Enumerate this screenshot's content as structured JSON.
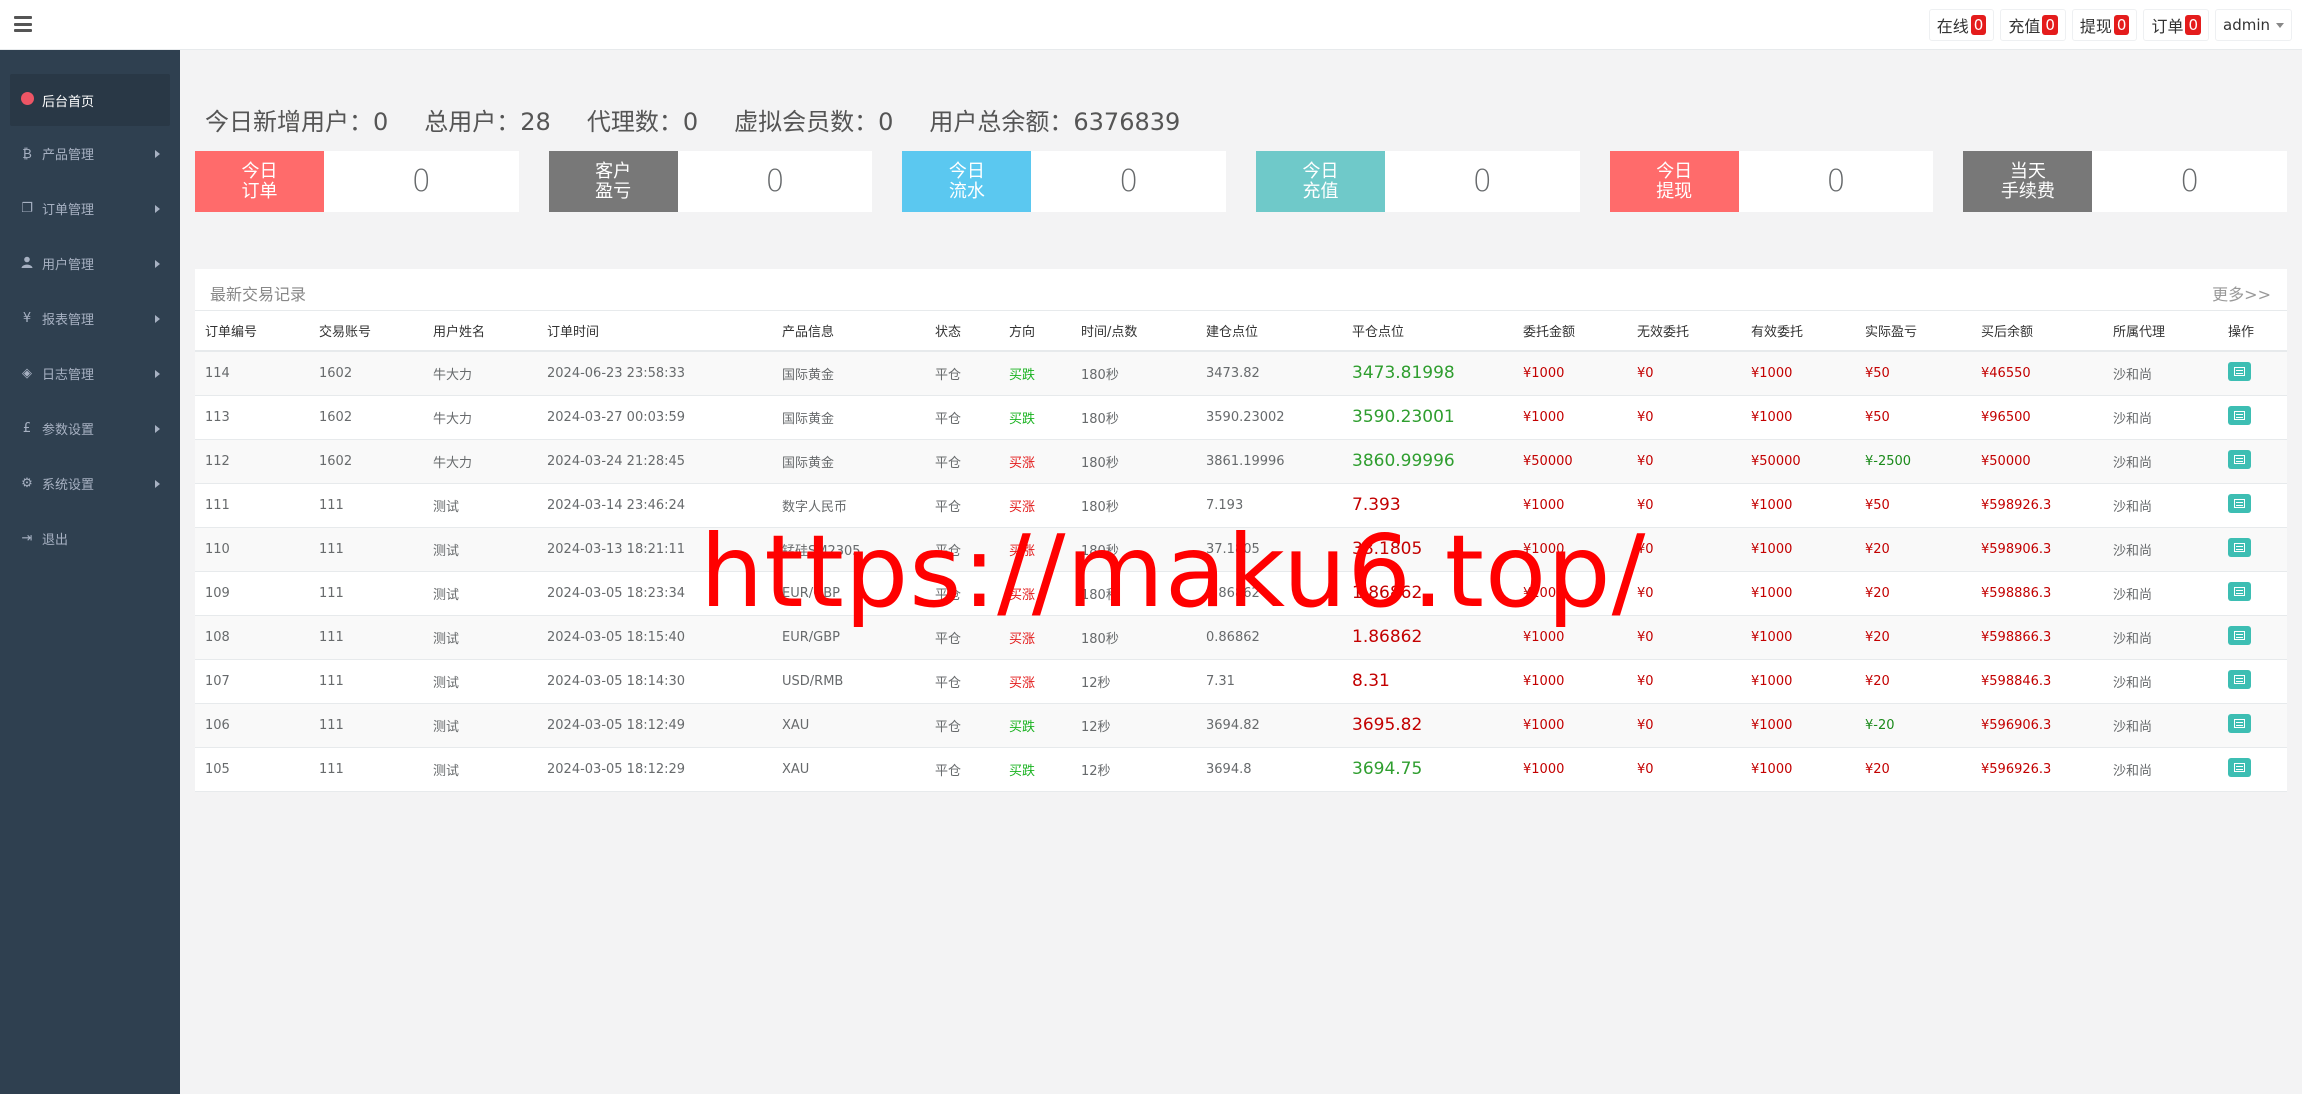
{
  "topbar": {
    "items": [
      {
        "label": "在线",
        "count": "0"
      },
      {
        "label": "充值",
        "count": "0"
      },
      {
        "label": "提现",
        "count": "0"
      },
      {
        "label": "订单",
        "count": "0"
      }
    ],
    "user": "admin"
  },
  "sidebar": {
    "items": [
      {
        "label": "后台首页",
        "icon": "dashboard-icon",
        "glyph": ""
      },
      {
        "label": "产品管理",
        "icon": "bitcoin-icon",
        "glyph": "₿"
      },
      {
        "label": "订单管理",
        "icon": "copy-icon",
        "glyph": "❐"
      },
      {
        "label": "用户管理",
        "icon": "user-icon",
        "glyph": "👤"
      },
      {
        "label": "报表管理",
        "icon": "yen-icon",
        "glyph": "¥"
      },
      {
        "label": "日志管理",
        "icon": "tag-icon",
        "glyph": "◈"
      },
      {
        "label": "参数设置",
        "icon": "pound-icon",
        "glyph": "£"
      },
      {
        "label": "系统设置",
        "icon": "gears-icon",
        "glyph": "⚙"
      },
      {
        "label": "退出",
        "icon": "sign-out-icon",
        "glyph": "⇥"
      }
    ]
  },
  "stats": [
    {
      "label": "今日新增用户：0"
    },
    {
      "label": "总用户：28"
    },
    {
      "label": "代理数：0"
    },
    {
      "label": "虚拟会员数：0"
    },
    {
      "label": "用户总余额：6376839"
    }
  ],
  "cards": [
    {
      "label": "今日\n订单",
      "value": "0",
      "color": "#ff6b6b"
    },
    {
      "label": "客户\n盈亏",
      "value": "0",
      "color": "#787878"
    },
    {
      "label": "今日\n流水",
      "value": "0",
      "color": "#5bc8f0"
    },
    {
      "label": "今日\n充值",
      "value": "0",
      "color": "#6fc9c9"
    },
    {
      "label": "今日\n提现",
      "value": "0",
      "color": "#ff6b6b"
    },
    {
      "label": "当天\n手续费",
      "value": "0",
      "color": "#787878"
    }
  ],
  "panel": {
    "title": "最新交易记录",
    "more": "更多>>"
  },
  "table": {
    "headers": [
      "订单编号",
      "交易账号",
      "用户姓名",
      "订单时间",
      "产品信息",
      "状态",
      "方向",
      "时间/点数",
      "建仓点位",
      "平仓点位",
      "委托金额",
      "无效委托",
      "有效委托",
      "实际盈亏",
      "买后余额",
      "所属代理",
      "操作"
    ],
    "rows": [
      {
        "id": "114",
        "account": "1602",
        "name": "牛大力",
        "time": "2024-06-23 23:58:33",
        "product": "国际黄金",
        "status": "平仓",
        "direction": "买跌",
        "dir_type": "buy",
        "duration": "180秒",
        "open": "3473.82",
        "close": "3473.81998",
        "close_type": "green",
        "amount": "¥1000",
        "invalid": "¥0",
        "valid": "¥1000",
        "pnl": "¥50",
        "pnl_type": "red",
        "balance": "¥46550",
        "agent": "沙和尚"
      },
      {
        "id": "113",
        "account": "1602",
        "name": "牛大力",
        "time": "2024-03-27 00:03:59",
        "product": "国际黄金",
        "status": "平仓",
        "direction": "买跌",
        "dir_type": "buy",
        "duration": "180秒",
        "open": "3590.23002",
        "close": "3590.23001",
        "close_type": "green",
        "amount": "¥1000",
        "invalid": "¥0",
        "valid": "¥1000",
        "pnl": "¥50",
        "pnl_type": "red",
        "balance": "¥96500",
        "agent": "沙和尚"
      },
      {
        "id": "112",
        "account": "1602",
        "name": "牛大力",
        "time": "2024-03-24 21:28:45",
        "product": "国际黄金",
        "status": "平仓",
        "direction": "买涨",
        "dir_type": "sell",
        "duration": "180秒",
        "open": "3861.19996",
        "close": "3860.99996",
        "close_type": "green",
        "amount": "¥50000",
        "invalid": "¥0",
        "valid": "¥50000",
        "pnl": "¥-2500",
        "pnl_type": "green",
        "balance": "¥50000",
        "agent": "沙和尚"
      },
      {
        "id": "111",
        "account": "111",
        "name": "测试",
        "time": "2024-03-14 23:46:24",
        "product": "数字人民币",
        "status": "平仓",
        "direction": "买涨",
        "dir_type": "sell",
        "duration": "180秒",
        "open": "7.193",
        "close": "7.393",
        "close_type": "red",
        "amount": "¥1000",
        "invalid": "¥0",
        "valid": "¥1000",
        "pnl": "¥50",
        "pnl_type": "red",
        "balance": "¥598926.3",
        "agent": "沙和尚"
      },
      {
        "id": "110",
        "account": "111",
        "name": "测试",
        "time": "2024-03-13 18:21:11",
        "product": "锰硅SM2305",
        "status": "平仓",
        "direction": "买涨",
        "dir_type": "sell",
        "duration": "180秒",
        "open": "37.1805",
        "close": "38.1805",
        "close_type": "red",
        "amount": "¥1000",
        "invalid": "¥0",
        "valid": "¥1000",
        "pnl": "¥20",
        "pnl_type": "red",
        "balance": "¥598906.3",
        "agent": "沙和尚"
      },
      {
        "id": "109",
        "account": "111",
        "name": "测试",
        "time": "2024-03-05 18:23:34",
        "product": "EUR/GBP",
        "status": "平仓",
        "direction": "买涨",
        "dir_type": "sell",
        "duration": "180秒",
        "open": "0.86862",
        "close": "1.86862",
        "close_type": "red",
        "amount": "¥1000",
        "invalid": "¥0",
        "valid": "¥1000",
        "pnl": "¥20",
        "pnl_type": "red",
        "balance": "¥598886.3",
        "agent": "沙和尚"
      },
      {
        "id": "108",
        "account": "111",
        "name": "测试",
        "time": "2024-03-05 18:15:40",
        "product": "EUR/GBP",
        "status": "平仓",
        "direction": "买涨",
        "dir_type": "sell",
        "duration": "180秒",
        "open": "0.86862",
        "close": "1.86862",
        "close_type": "red",
        "amount": "¥1000",
        "invalid": "¥0",
        "valid": "¥1000",
        "pnl": "¥20",
        "pnl_type": "red",
        "balance": "¥598866.3",
        "agent": "沙和尚"
      },
      {
        "id": "107",
        "account": "111",
        "name": "测试",
        "time": "2024-03-05 18:14:30",
        "product": "USD/RMB",
        "status": "平仓",
        "direction": "买涨",
        "dir_type": "sell",
        "duration": "12秒",
        "open": "7.31",
        "close": "8.31",
        "close_type": "red",
        "amount": "¥1000",
        "invalid": "¥0",
        "valid": "¥1000",
        "pnl": "¥20",
        "pnl_type": "red",
        "balance": "¥598846.3",
        "agent": "沙和尚"
      },
      {
        "id": "106",
        "account": "111",
        "name": "测试",
        "time": "2024-03-05 18:12:49",
        "product": "XAU",
        "status": "平仓",
        "direction": "买跌",
        "dir_type": "buy",
        "duration": "12秒",
        "open": "3694.82",
        "close": "3695.82",
        "close_type": "red",
        "amount": "¥1000",
        "invalid": "¥0",
        "valid": "¥1000",
        "pnl": "¥-20",
        "pnl_type": "green",
        "balance": "¥596906.3",
        "agent": "沙和尚"
      },
      {
        "id": "105",
        "account": "111",
        "name": "测试",
        "time": "2024-03-05 18:12:29",
        "product": "XAU",
        "status": "平仓",
        "direction": "买跌",
        "dir_type": "buy",
        "duration": "12秒",
        "open": "3694.8",
        "close": "3694.75",
        "close_type": "green",
        "amount": "¥1000",
        "invalid": "¥0",
        "valid": "¥1000",
        "pnl": "¥20",
        "pnl_type": "red",
        "balance": "¥596926.3",
        "agent": "沙和尚"
      }
    ]
  },
  "watermark": "https://maku6.top/"
}
